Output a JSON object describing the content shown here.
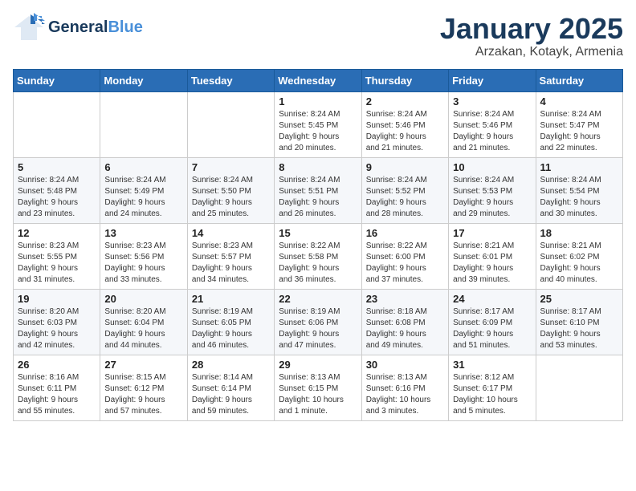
{
  "header": {
    "logo_line1": "General",
    "logo_line2": "Blue",
    "title": "January 2025",
    "subtitle": "Arzakan, Kotayk, Armenia"
  },
  "weekdays": [
    "Sunday",
    "Monday",
    "Tuesday",
    "Wednesday",
    "Thursday",
    "Friday",
    "Saturday"
  ],
  "weeks": [
    [
      {
        "day": "",
        "info": ""
      },
      {
        "day": "",
        "info": ""
      },
      {
        "day": "",
        "info": ""
      },
      {
        "day": "1",
        "info": "Sunrise: 8:24 AM\nSunset: 5:45 PM\nDaylight: 9 hours\nand 20 minutes."
      },
      {
        "day": "2",
        "info": "Sunrise: 8:24 AM\nSunset: 5:46 PM\nDaylight: 9 hours\nand 21 minutes."
      },
      {
        "day": "3",
        "info": "Sunrise: 8:24 AM\nSunset: 5:46 PM\nDaylight: 9 hours\nand 21 minutes."
      },
      {
        "day": "4",
        "info": "Sunrise: 8:24 AM\nSunset: 5:47 PM\nDaylight: 9 hours\nand 22 minutes."
      }
    ],
    [
      {
        "day": "5",
        "info": "Sunrise: 8:24 AM\nSunset: 5:48 PM\nDaylight: 9 hours\nand 23 minutes."
      },
      {
        "day": "6",
        "info": "Sunrise: 8:24 AM\nSunset: 5:49 PM\nDaylight: 9 hours\nand 24 minutes."
      },
      {
        "day": "7",
        "info": "Sunrise: 8:24 AM\nSunset: 5:50 PM\nDaylight: 9 hours\nand 25 minutes."
      },
      {
        "day": "8",
        "info": "Sunrise: 8:24 AM\nSunset: 5:51 PM\nDaylight: 9 hours\nand 26 minutes."
      },
      {
        "day": "9",
        "info": "Sunrise: 8:24 AM\nSunset: 5:52 PM\nDaylight: 9 hours\nand 28 minutes."
      },
      {
        "day": "10",
        "info": "Sunrise: 8:24 AM\nSunset: 5:53 PM\nDaylight: 9 hours\nand 29 minutes."
      },
      {
        "day": "11",
        "info": "Sunrise: 8:24 AM\nSunset: 5:54 PM\nDaylight: 9 hours\nand 30 minutes."
      }
    ],
    [
      {
        "day": "12",
        "info": "Sunrise: 8:23 AM\nSunset: 5:55 PM\nDaylight: 9 hours\nand 31 minutes."
      },
      {
        "day": "13",
        "info": "Sunrise: 8:23 AM\nSunset: 5:56 PM\nDaylight: 9 hours\nand 33 minutes."
      },
      {
        "day": "14",
        "info": "Sunrise: 8:23 AM\nSunset: 5:57 PM\nDaylight: 9 hours\nand 34 minutes."
      },
      {
        "day": "15",
        "info": "Sunrise: 8:22 AM\nSunset: 5:58 PM\nDaylight: 9 hours\nand 36 minutes."
      },
      {
        "day": "16",
        "info": "Sunrise: 8:22 AM\nSunset: 6:00 PM\nDaylight: 9 hours\nand 37 minutes."
      },
      {
        "day": "17",
        "info": "Sunrise: 8:21 AM\nSunset: 6:01 PM\nDaylight: 9 hours\nand 39 minutes."
      },
      {
        "day": "18",
        "info": "Sunrise: 8:21 AM\nSunset: 6:02 PM\nDaylight: 9 hours\nand 40 minutes."
      }
    ],
    [
      {
        "day": "19",
        "info": "Sunrise: 8:20 AM\nSunset: 6:03 PM\nDaylight: 9 hours\nand 42 minutes."
      },
      {
        "day": "20",
        "info": "Sunrise: 8:20 AM\nSunset: 6:04 PM\nDaylight: 9 hours\nand 44 minutes."
      },
      {
        "day": "21",
        "info": "Sunrise: 8:19 AM\nSunset: 6:05 PM\nDaylight: 9 hours\nand 46 minutes."
      },
      {
        "day": "22",
        "info": "Sunrise: 8:19 AM\nSunset: 6:06 PM\nDaylight: 9 hours\nand 47 minutes."
      },
      {
        "day": "23",
        "info": "Sunrise: 8:18 AM\nSunset: 6:08 PM\nDaylight: 9 hours\nand 49 minutes."
      },
      {
        "day": "24",
        "info": "Sunrise: 8:17 AM\nSunset: 6:09 PM\nDaylight: 9 hours\nand 51 minutes."
      },
      {
        "day": "25",
        "info": "Sunrise: 8:17 AM\nSunset: 6:10 PM\nDaylight: 9 hours\nand 53 minutes."
      }
    ],
    [
      {
        "day": "26",
        "info": "Sunrise: 8:16 AM\nSunset: 6:11 PM\nDaylight: 9 hours\nand 55 minutes."
      },
      {
        "day": "27",
        "info": "Sunrise: 8:15 AM\nSunset: 6:12 PM\nDaylight: 9 hours\nand 57 minutes."
      },
      {
        "day": "28",
        "info": "Sunrise: 8:14 AM\nSunset: 6:14 PM\nDaylight: 9 hours\nand 59 minutes."
      },
      {
        "day": "29",
        "info": "Sunrise: 8:13 AM\nSunset: 6:15 PM\nDaylight: 10 hours\nand 1 minute."
      },
      {
        "day": "30",
        "info": "Sunrise: 8:13 AM\nSunset: 6:16 PM\nDaylight: 10 hours\nand 3 minutes."
      },
      {
        "day": "31",
        "info": "Sunrise: 8:12 AM\nSunset: 6:17 PM\nDaylight: 10 hours\nand 5 minutes."
      },
      {
        "day": "",
        "info": ""
      }
    ]
  ]
}
